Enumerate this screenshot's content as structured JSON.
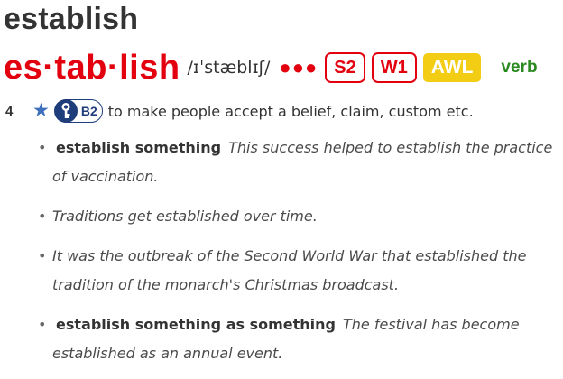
{
  "entry": {
    "headword": "establish",
    "hyphenation": "es·tab·lish",
    "pronunciation": "/ɪˈstæblɪʃ/",
    "frequency_dots": "●●●",
    "spoken_freq": "S2",
    "written_freq": "W1",
    "awl": "AWL",
    "part_of_speech": "verb"
  },
  "sense": {
    "number": "4",
    "star_icon": "star-icon",
    "level_icon": "key-icon",
    "level": "B2",
    "definition": "to make people accept a belief, claim, custom etc."
  },
  "examples": [
    {
      "pattern": "establish something",
      "text": "This success helped to establish the practice of vaccination."
    },
    {
      "pattern": "",
      "text": "Traditions get established over time."
    },
    {
      "pattern": "",
      "text": "It was the outbreak of the Second World War that established the tradition of the monarch's Christmas broadcast."
    },
    {
      "pattern": "establish something as something",
      "text": "The festival has become established as an annual event."
    }
  ],
  "colors": {
    "red": "#e3000f",
    "awl_yellow": "#f3cc14",
    "verb_green": "#2a8a20",
    "level_navy": "#1f3d7a",
    "star_blue": "#3e6fbd"
  }
}
